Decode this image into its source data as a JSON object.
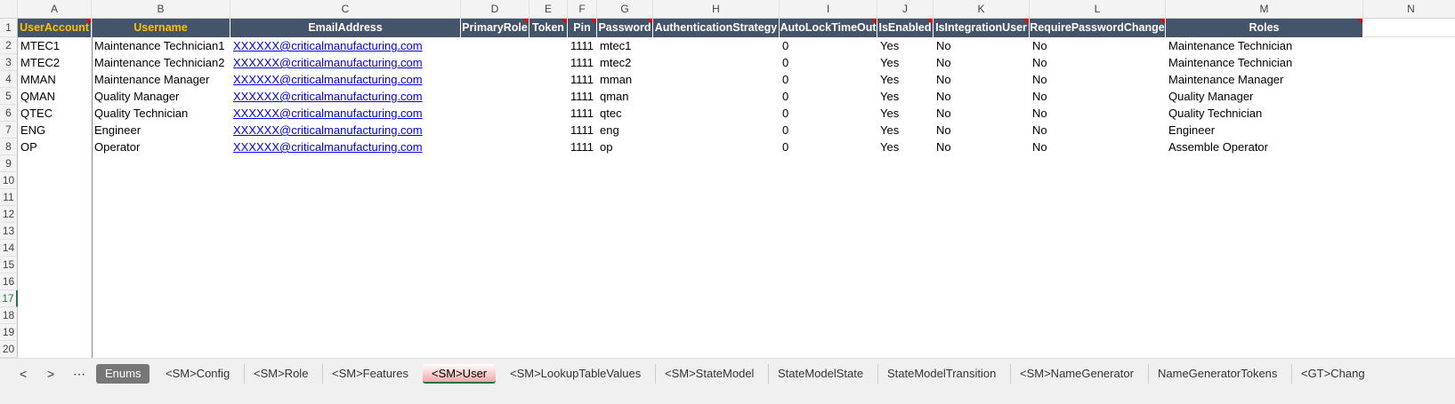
{
  "columns": [
    "A",
    "B",
    "C",
    "D",
    "E",
    "F",
    "G",
    "H",
    "I",
    "J",
    "K",
    "L",
    "M",
    "N"
  ],
  "headers": [
    "UserAccount",
    "Username",
    "EmailAddress",
    "PrimaryRole",
    "Token",
    "Pin",
    "Password",
    "AuthenticationStrategy",
    "AutoLockTimeOut",
    "IsEnabled",
    "IsIntegrationUser",
    "RequirePasswordChange",
    "Roles"
  ],
  "rows": [
    [
      "MTEC1",
      "Maintenance Technician1",
      "XXXXXX@criticalmanufacturing.com",
      "",
      "",
      "1111",
      "mtec1",
      "",
      "0",
      "Yes",
      "No",
      "No",
      "Maintenance Technician"
    ],
    [
      "MTEC2",
      "Maintenance Technician2",
      "XXXXXX@criticalmanufacturing.com",
      "",
      "",
      "1111",
      "mtec2",
      "",
      "0",
      "Yes",
      "No",
      "No",
      "Maintenance Technician"
    ],
    [
      "MMAN",
      "Maintenance Manager",
      "XXXXXX@criticalmanufacturing.com",
      "",
      "",
      "1111",
      "mman",
      "",
      "0",
      "Yes",
      "No",
      "No",
      "Maintenance Manager"
    ],
    [
      "QMAN",
      "Quality Manager",
      "XXXXXX@criticalmanufacturing.com",
      "",
      "",
      "1111",
      "qman",
      "",
      "0",
      "Yes",
      "No",
      "No",
      "Quality Manager"
    ],
    [
      "QTEC",
      "Quality Technician",
      "XXXXXX@criticalmanufacturing.com",
      "",
      "",
      "1111",
      "qtec",
      "",
      "0",
      "Yes",
      "No",
      "No",
      "Quality Technician"
    ],
    [
      "ENG",
      "Engineer",
      "XXXXXX@criticalmanufacturing.com",
      "",
      "",
      "1111",
      "eng",
      "",
      "0",
      "Yes",
      "No",
      "No",
      "Engineer"
    ],
    [
      "OP",
      "Operator",
      "XXXXXX@criticalmanufacturing.com",
      "",
      "",
      "1111",
      "op",
      "",
      "0",
      "Yes",
      "No",
      "No",
      "Assemble Operator"
    ]
  ],
  "row_numbers": [
    "1",
    "2",
    "3",
    "4",
    "5",
    "6",
    "7",
    "8",
    "9",
    "10",
    "11",
    "12",
    "13",
    "14",
    "15",
    "16",
    "17",
    "18",
    "19",
    "20"
  ],
  "selected_row": "17",
  "sheet_nav": {
    "prev": "<",
    "next": ">",
    "more": "⋯"
  },
  "tabs": [
    "Enums",
    "<SM>Config",
    "<SM>Role",
    "<SM>Features",
    "<SM>User",
    "<SM>LookupTableValues",
    "<SM>StateModel",
    "StateModelState",
    "StateModelTransition",
    "<SM>NameGenerator",
    "NameGeneratorTokens",
    "<GT>Chang"
  ],
  "active_tab": "<SM>User"
}
